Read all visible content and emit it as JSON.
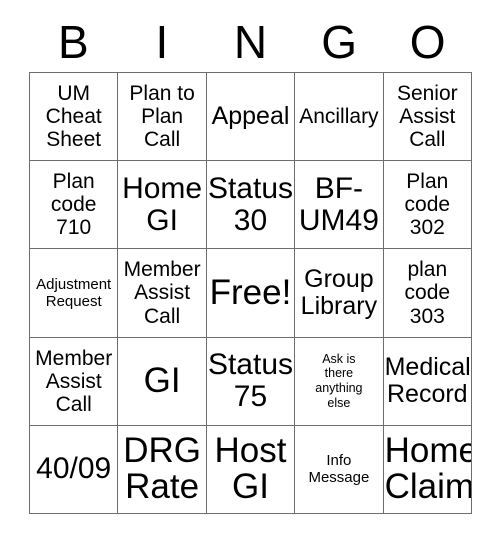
{
  "card": {
    "title": "BINGO",
    "header_letters": [
      "B",
      "I",
      "N",
      "G",
      "O"
    ],
    "colors": {
      "text": "#000000",
      "grid_line": "#6d6d6d",
      "background": "#ffffff"
    },
    "rows": [
      [
        {
          "label": "UM\nCheat\nSheet",
          "size": "m",
          "free": false
        },
        {
          "label": "Plan to\nPlan\nCall",
          "size": "m",
          "free": false
        },
        {
          "label": "Appeal",
          "size": "l",
          "free": false
        },
        {
          "label": "Ancillary",
          "size": "m",
          "free": false
        },
        {
          "label": "Senior\nAssist\nCall",
          "size": "m",
          "free": false
        }
      ],
      [
        {
          "label": "Plan\ncode\n710",
          "size": "m",
          "free": false
        },
        {
          "label": "Home\nGI",
          "size": "xl",
          "free": false
        },
        {
          "label": "Status\n30",
          "size": "xl",
          "free": false
        },
        {
          "label": "BF-\nUM49",
          "size": "xl",
          "free": false
        },
        {
          "label": "Plan\ncode\n302",
          "size": "m",
          "free": false
        }
      ],
      [
        {
          "label": "Adjustment\nRequest",
          "size": "s",
          "free": false
        },
        {
          "label": "Member\nAssist\nCall",
          "size": "m",
          "free": false
        },
        {
          "label": "Free!",
          "size": "xxl",
          "free": true
        },
        {
          "label": "Group\nLibrary",
          "size": "l",
          "free": false
        },
        {
          "label": "plan\ncode\n303",
          "size": "m",
          "free": false
        }
      ],
      [
        {
          "label": "Member\nAssist\nCall",
          "size": "m",
          "free": false
        },
        {
          "label": "GI",
          "size": "xxl",
          "free": false
        },
        {
          "label": "Status\n75",
          "size": "xl",
          "free": false
        },
        {
          "label": "Ask is\nthere\nanything\nelse",
          "size": "xs",
          "free": false
        },
        {
          "label": "Medical\nRecord",
          "size": "l",
          "free": false
        }
      ],
      [
        {
          "label": "40/09",
          "size": "xl",
          "free": false
        },
        {
          "label": "DRG\nRate",
          "size": "xxl",
          "free": false
        },
        {
          "label": "Host\nGI",
          "size": "xxl",
          "free": false
        },
        {
          "label": "Info\nMessage",
          "size": "s",
          "free": false
        },
        {
          "label": "Home\nClaim",
          "size": "xxl",
          "free": false
        }
      ]
    ]
  }
}
